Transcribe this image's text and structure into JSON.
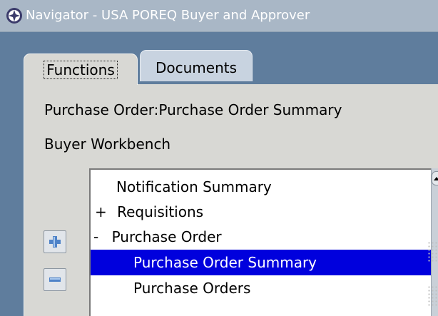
{
  "window": {
    "title": "Navigator - USA POREQ Buyer and Approver",
    "icon": "oracle-apps-icon"
  },
  "tabs": [
    {
      "label": "Functions",
      "selected": true
    },
    {
      "label": "Documents",
      "selected": false
    }
  ],
  "panel": {
    "path_label": "Purchase Order:Purchase Order Summary",
    "top_label": "Buyer Workbench"
  },
  "tree": {
    "items": [
      {
        "label": "Notification Summary",
        "prefix": "",
        "level": 1,
        "selected": false
      },
      {
        "label": "Requisitions",
        "prefix": "+",
        "level": 0,
        "selected": false
      },
      {
        "label": "Purchase Order",
        "prefix": "-",
        "level": 0,
        "selected": false
      },
      {
        "label": "Purchase Order Summary",
        "prefix": "",
        "level": 2,
        "selected": true
      },
      {
        "label": "Purchase Orders",
        "prefix": "",
        "level": 2,
        "selected": false
      }
    ]
  },
  "buttons": {
    "expand_icon": "plus-icon",
    "collapse_icon": "minus-icon"
  },
  "colors": {
    "selection": "#0000dd",
    "titlebar": "#a9b7c6",
    "panel": "#d8d8d4",
    "frame": "#5f7d9d"
  }
}
